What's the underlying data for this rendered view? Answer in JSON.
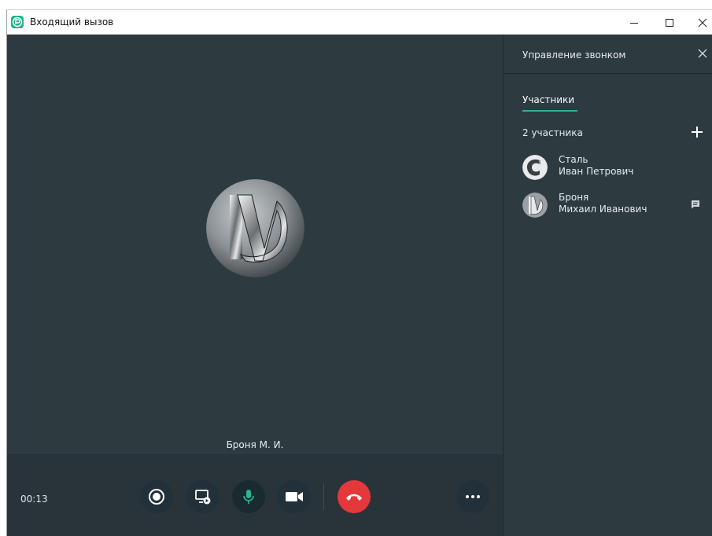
{
  "window": {
    "title": "Входящий вызов",
    "minimize_icon": "minimize-icon",
    "maximize_icon": "maximize-icon",
    "close_icon": "close-icon"
  },
  "call": {
    "caller_name": "Броня М. И.",
    "timer": "00:13",
    "controls": [
      {
        "name": "record-button",
        "icon": "record-icon"
      },
      {
        "name": "share-screen-button",
        "icon": "screen-share-icon"
      },
      {
        "name": "microphone-button",
        "icon": "microphone-icon",
        "active": true
      },
      {
        "name": "camera-button",
        "icon": "video-camera-icon"
      },
      {
        "name": "hangup-button",
        "icon": "phone-hangup-icon"
      },
      {
        "name": "more-button",
        "icon": "more-dots-icon"
      }
    ]
  },
  "panel": {
    "title": "Управление звонком",
    "tab": "Участники",
    "participants_count": "2 участника",
    "participants": [
      {
        "line1": "Сталь",
        "line2": "Иван Петрович"
      },
      {
        "line1": "Броня",
        "line2": "Михаил Иванович"
      }
    ]
  },
  "colors": {
    "background": "#2d3a40",
    "accent": "#2bb39a",
    "hangup": "#e5383b"
  }
}
